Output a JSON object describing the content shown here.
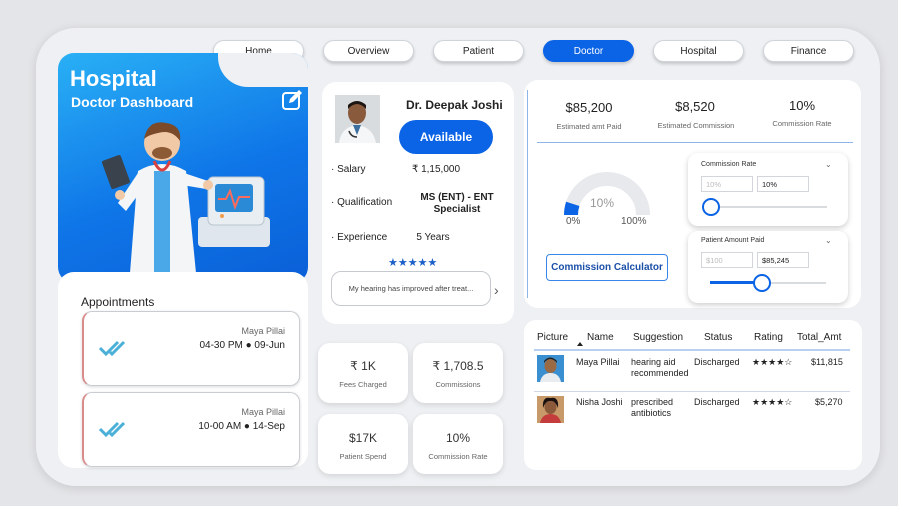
{
  "nav": [
    "Home",
    "Overview",
    "Patient",
    "Doctor",
    "Hospital",
    "Finance"
  ],
  "nav_active": "Doctor",
  "hero": {
    "title": "Hospital",
    "subtitle": "Doctor Dashboard",
    "edit_icon": "edit-icon"
  },
  "appointments": {
    "title": "Appointments",
    "items": [
      {
        "name": "Maya Pillai",
        "time": "04-30 PM ● 09-Jun"
      },
      {
        "name": "Maya Pillai",
        "time": "10-00 AM ● 14-Sep"
      }
    ]
  },
  "doctor": {
    "name": "Dr. Deepak Joshi",
    "status": "Available",
    "fields": [
      {
        "label": "· Salary",
        "value": "₹ 1,15,000"
      },
      {
        "label": "· Qualification",
        "value": "MS (ENT) - ENT Specialist"
      },
      {
        "label": "· Experience",
        "value": "5 Years"
      }
    ],
    "stars": "★★★★★",
    "review": "My hearing has improved after treat...",
    "review_next_icon": "chevron-right-icon"
  },
  "commission": {
    "kpis": [
      {
        "value": "$85,200",
        "label": "Estimated amt Paid"
      },
      {
        "value": "$8,520",
        "label": "Estimated Commission"
      },
      {
        "value": "10%",
        "label": "Commission Rate"
      }
    ],
    "gauge": {
      "value": "10%",
      "min": "0%",
      "max": "100%",
      "fraction": 0.1
    },
    "calculator_label": "Commission Calculator",
    "rate_slider": {
      "title": "Commission Rate",
      "min_value": "10%",
      "current_value": "10%",
      "level": 0
    },
    "amount_slider": {
      "title": "Patient Amount Paid",
      "min_value": "$100",
      "current_value": "$85,245",
      "level": 0.45
    }
  },
  "mini_kpis": [
    {
      "value": "₹ 1K",
      "label": "Fees Charged"
    },
    {
      "value": "₹ 1,708.5",
      "label": "Commissions"
    },
    {
      "value": "$17K",
      "label": "Patient Spend"
    },
    {
      "value": "10%",
      "label": "Commission Rate"
    }
  ],
  "table": {
    "columns": [
      "Picture",
      "Name",
      "Suggestion",
      "Status",
      "Rating",
      "Total_Amt"
    ],
    "rows": [
      {
        "name": "Maya Pillai",
        "suggestion": "hearing aid recommended",
        "status": "Discharged",
        "rating": "★★★★☆",
        "total": "$11,815"
      },
      {
        "name": "Nisha Joshi",
        "suggestion": "prescribed antibiotics",
        "status": "Discharged",
        "rating": "★★★★☆",
        "total": "$5,270"
      }
    ]
  },
  "colors": {
    "accent": "#0b63e5",
    "hero_start": "#29b0f5",
    "hero_end": "#0a5fd7",
    "background": "#eef0f3"
  }
}
